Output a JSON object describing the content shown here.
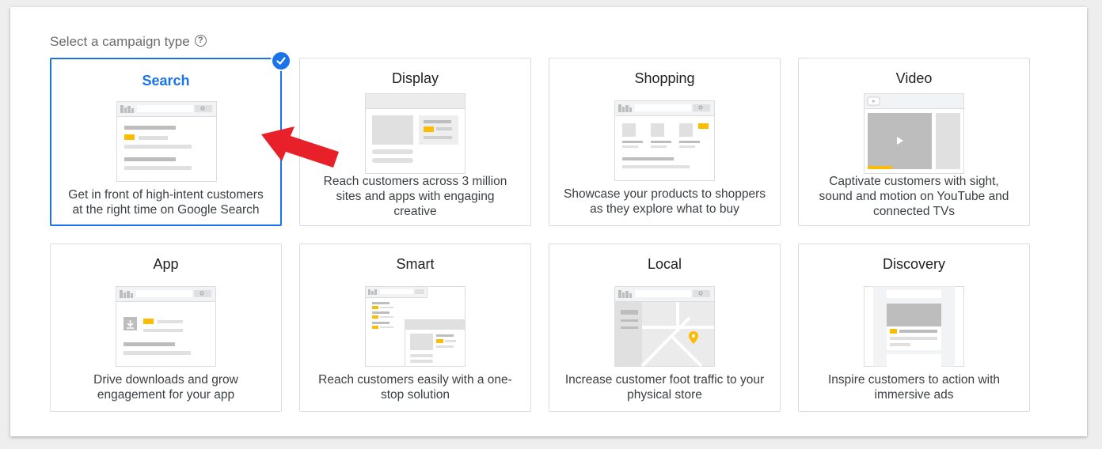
{
  "header": {
    "label": "Select a campaign type",
    "help_icon": "?"
  },
  "cards": [
    {
      "id": "search",
      "title": "Search",
      "description_lines": [
        "Get in front of high-intent customers",
        "at the right time on Google Search"
      ],
      "selected": true
    },
    {
      "id": "display",
      "title": "Display",
      "description_lines": [
        "Reach customers across 3 million",
        "sites and apps with engaging",
        "creative"
      ],
      "selected": false
    },
    {
      "id": "shopping",
      "title": "Shopping",
      "description_lines": [
        "Showcase your products to shoppers",
        "as they explore what to buy"
      ],
      "selected": false
    },
    {
      "id": "video",
      "title": "Video",
      "description_lines": [
        "Captivate customers with sight,",
        "sound and motion on YouTube and",
        "connected TVs"
      ],
      "selected": false
    },
    {
      "id": "app",
      "title": "App",
      "description_lines": [
        "Drive downloads and grow",
        "engagement for your app"
      ],
      "selected": false
    },
    {
      "id": "smart",
      "title": "Smart",
      "description_lines": [
        "Reach customers easily with a one-",
        "stop solution"
      ],
      "selected": false
    },
    {
      "id": "local",
      "title": "Local",
      "description_lines": [
        "Increase customer foot traffic to your",
        "physical store"
      ],
      "selected": false
    },
    {
      "id": "discovery",
      "title": "Discovery",
      "description_lines": [
        "Inspire customers to action with",
        "immersive ads"
      ],
      "selected": false
    }
  ],
  "colors": {
    "accent": "#1a73e8",
    "yellow_highlight": "#fbbc04",
    "annotation_arrow": "#e8202a"
  },
  "icons": {
    "selected_badge": "check-circle-icon",
    "annotation": "red-arrow-pointer"
  }
}
